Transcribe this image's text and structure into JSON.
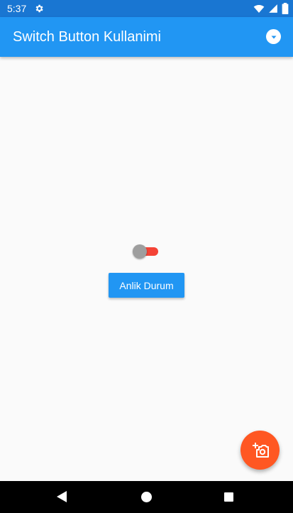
{
  "status_bar": {
    "time": "5:37",
    "icons": [
      "settings-icon",
      "wifi-icon",
      "signal-icon",
      "battery-icon"
    ]
  },
  "app_bar": {
    "title": "Switch Button Kullanimi",
    "menu_icon": "dropdown-circle-icon"
  },
  "main": {
    "switch": {
      "checked": false,
      "track_color": "#f44336",
      "thumb_color": "#9e9e9e"
    },
    "button_label": "Anlik Durum"
  },
  "fab": {
    "icon": "add-a-photo-icon",
    "color": "#ff5722"
  },
  "nav_bar": {
    "icons": [
      "back-icon",
      "home-icon",
      "recents-icon"
    ]
  },
  "colors": {
    "primary": "#2196f3",
    "primary_dark": "#1976d2",
    "background": "#fafafa"
  }
}
